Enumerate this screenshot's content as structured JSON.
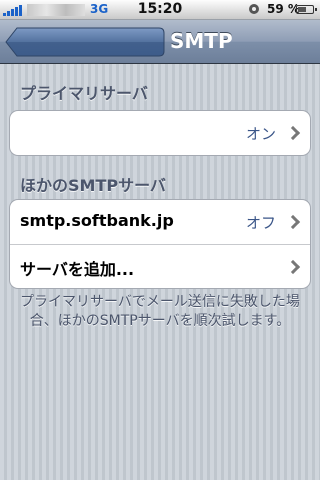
{
  "status_bar": {
    "network": "3G",
    "time": "15:20",
    "battery_percent": "59 %",
    "battery_level": 0.59,
    "icons": [
      "signal-bars-icon",
      "alarm-clock-icon",
      "battery-icon"
    ]
  },
  "nav_bar": {
    "title": "SMTP",
    "back_label": ""
  },
  "primary_section": {
    "header": "プライマリサーバ",
    "rows": [
      {
        "label": "",
        "value": "オン"
      }
    ]
  },
  "other_section": {
    "header": "ほかのSMTPサーバ",
    "rows": [
      {
        "label": "smtp.softbank.jp",
        "value": "オフ"
      },
      {
        "label": "サーバを追加...",
        "value": ""
      }
    ]
  },
  "footer": {
    "note": "プライマリサーバでメール送信に失敗した場合、ほかのSMTPサーバを順次試します。"
  },
  "colors": {
    "nav_gradient_top": "#b1bccc",
    "nav_gradient_bottom": "#6d7f9a",
    "back_button": "#4a6a9c",
    "value_text": "#3a5588",
    "section_header": "#4c566c",
    "background": "#c5ccd4",
    "status_icon_blue": "#1b62c9"
  }
}
